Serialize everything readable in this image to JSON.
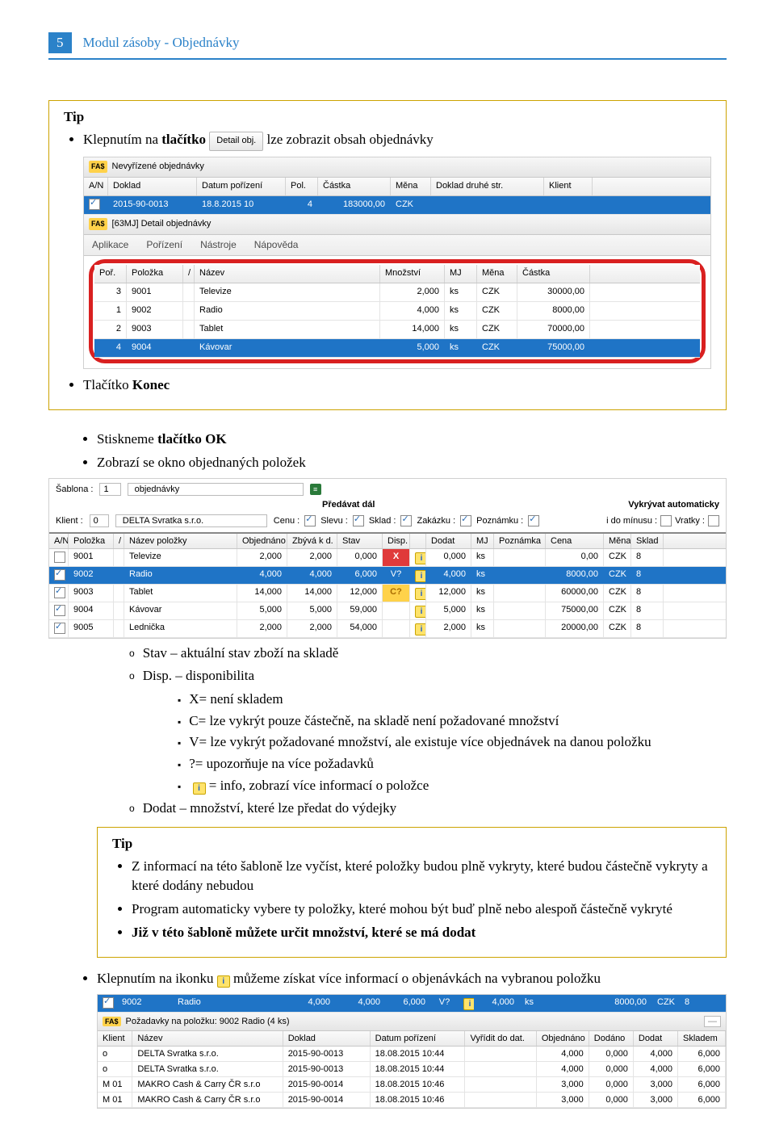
{
  "header": {
    "page_num": "5",
    "title": "Modul zásoby - Objednávky"
  },
  "tip1": {
    "title": "Tip",
    "b1_pre": "Klepnutím na ",
    "b1_bold": "tlačítko",
    "b1_btn": "Detail obj.",
    "b1_post": " lze zobrazit obsah objednávky",
    "b2_pre": "Tlačítko ",
    "b2_bold": "Konec"
  },
  "shot1": {
    "title_top": "Nevyřízené objednávky",
    "cols_top": [
      "A/N",
      "Doklad",
      "Datum pořízení",
      "Pol.",
      "Částka",
      "Měna",
      "Doklad druhé str.",
      "Klient"
    ],
    "row_top": {
      "an_on": true,
      "doklad": "2015-90-0013",
      "datum": "18.8.2015 10",
      "pol": "4",
      "castka": "183000,00",
      "mena": "CZK",
      "druha": "",
      "klient": ""
    },
    "title_detail": "[63MJ] Detail objednávky",
    "menu": [
      "Aplikace",
      "Pořízení",
      "Nástroje",
      "Nápověda"
    ],
    "detail_cols": [
      "Poř.",
      "Položka",
      "/",
      "Název",
      "Množství",
      "MJ",
      "Měna",
      "Částka"
    ],
    "detail_rows": [
      {
        "por": "3",
        "polozka": "9001",
        "nazev": "Televize",
        "mnoz": "2,000",
        "mj": "ks",
        "mena": "CZK",
        "castka": "30000,00"
      },
      {
        "por": "1",
        "polozka": "9002",
        "nazev": "Radio",
        "mnoz": "4,000",
        "mj": "ks",
        "mena": "CZK",
        "castka": "8000,00"
      },
      {
        "por": "2",
        "polozka": "9003",
        "nazev": "Tablet",
        "mnoz": "14,000",
        "mj": "ks",
        "mena": "CZK",
        "castka": "70000,00"
      },
      {
        "por": "4",
        "polozka": "9004",
        "nazev": "Kávovar",
        "mnoz": "5,000",
        "mj": "ks",
        "mena": "CZK",
        "castka": "75000,00",
        "sel": true
      }
    ]
  },
  "mid": {
    "b1_pre": "Stiskneme ",
    "b1_bold": "tlačítko OK",
    "b2": "Zobrazí se okno objednaných položek"
  },
  "shot2": {
    "row1": {
      "sablona_lbl": "Šablona :",
      "sablona_no": "1",
      "sablona_name": "objednávky",
      "predavat": "Předávat dál",
      "vykryvat": "Vykrývat automaticky"
    },
    "row2": {
      "klient_lbl": "Klient :",
      "klient_no": "0",
      "klient_name": "DELTA Svratka s.r.o.",
      "chks": [
        {
          "lbl": "Cenu :",
          "on": true
        },
        {
          "lbl": "Slevu :",
          "on": true
        },
        {
          "lbl": "Sklad :",
          "on": true
        },
        {
          "lbl": "Zakázku :",
          "on": true
        },
        {
          "lbl": "Poznámku :",
          "on": true
        }
      ],
      "dominus_lbl": "i do mínusu :",
      "dominus_on": false,
      "vratky_lbl": "Vratky :",
      "vratky_on": false
    },
    "cols": [
      "A/N",
      "Položka",
      "/",
      "Název položky",
      "Objednáno",
      "Zbývá k d.",
      "Stav",
      "Disp.",
      "",
      "Dodat",
      "MJ",
      "Poznámka",
      "Cena",
      "Měna",
      "Sklad"
    ],
    "rows": [
      {
        "an": false,
        "pol": "9001",
        "naz": "Televize",
        "obj": "2,000",
        "zbyva": "2,000",
        "stav": "0,000",
        "disp": "X",
        "disp_cls": "status-red",
        "info": "i",
        "dodat": "0,000",
        "mj": "ks",
        "pozn": "",
        "cena": "0,00",
        "mena": "CZK",
        "sklad": "8"
      },
      {
        "an": true,
        "pol": "9002",
        "naz": "Radio",
        "obj": "4,000",
        "zbyva": "4,000",
        "stav": "6,000",
        "disp": "V?",
        "disp_cls": "",
        "info": "i",
        "dodat": "4,000",
        "mj": "ks",
        "pozn": "",
        "cena": "8000,00",
        "mena": "CZK",
        "sklad": "8",
        "sel": true
      },
      {
        "an": true,
        "pol": "9003",
        "naz": "Tablet",
        "obj": "14,000",
        "zbyva": "14,000",
        "stav": "12,000",
        "disp": "C?",
        "disp_cls": "status-yellow",
        "info": "i",
        "dodat": "12,000",
        "mj": "ks",
        "pozn": "",
        "cena": "60000,00",
        "mena": "CZK",
        "sklad": "8"
      },
      {
        "an": true,
        "pol": "9004",
        "naz": "Kávovar",
        "obj": "5,000",
        "zbyva": "5,000",
        "stav": "59,000",
        "disp": "",
        "disp_cls": "",
        "info": "i",
        "dodat": "5,000",
        "mj": "ks",
        "pozn": "",
        "cena": "75000,00",
        "mena": "CZK",
        "sklad": "8"
      },
      {
        "an": true,
        "pol": "9005",
        "naz": "Lednička",
        "obj": "2,000",
        "zbyva": "2,000",
        "stav": "54,000",
        "disp": "",
        "disp_cls": "",
        "info": "i",
        "dodat": "2,000",
        "mj": "ks",
        "pozn": "",
        "cena": "20000,00",
        "mena": "CZK",
        "sklad": "8"
      }
    ]
  },
  "legend": {
    "o1": "Stav – aktuální stav zboží na skladě",
    "o2": "Disp. – disponibilita",
    "s1": "X= není skladem",
    "s2": "C= lze vykrýt pouze částečně, na skladě není požadované množství",
    "s3": "V= lze vykrýt požadované množství, ale existuje více objednávek na danou položku",
    "s4": "?= upozorňuje na více požadavků",
    "s5_post": "= info, zobrazí více informací o položce",
    "o3": "Dodat – množství, které lze předat do výdejky"
  },
  "tip2": {
    "title": "Tip",
    "b1": "Z informací na této šabloně lze vyčíst, které položky budou plně vykryty, které budou částečně vykryty a které dodány nebudou",
    "b2": "Program automaticky vybere ty položky, které mohou být buď plně nebo alespoň částečně vykryté",
    "b3": "Již v této šabloně můžete určit množství, které se má dodat"
  },
  "last": {
    "pre": "Klepnutím na ikonku ",
    "post": " můžeme získat více informací o objenávkách na vybranou položku"
  },
  "shot3": {
    "top_row": {
      "pol": "9002",
      "naz": "Radio",
      "obj": "4,000",
      "zbyva": "4,000",
      "stav": "6,000",
      "disp": "V?",
      "dodat": "4,000",
      "mj": "ks",
      "cena": "8000,00",
      "mena": "CZK",
      "sklad": "8"
    },
    "title": "Požadavky na položku: 9002 Radio (4 ks)",
    "cols": [
      "Klient",
      "Název",
      "Doklad",
      "Datum pořízení",
      "Vyřídit do dat.",
      "Objednáno",
      "Dodáno",
      "Dodat",
      "Skladem"
    ],
    "rows": [
      {
        "klient": "o",
        "nazev": "DELTA Svratka s.r.o.",
        "doklad": "2015-90-0013",
        "datum": "18.08.2015 10:44",
        "vyridit": "",
        "obj": "4,000",
        "dod": "0,000",
        "dodat": "4,000",
        "skl": "6,000"
      },
      {
        "klient": "o",
        "nazev": "DELTA Svratka s.r.o.",
        "doklad": "2015-90-0013",
        "datum": "18.08.2015 10:44",
        "vyridit": "",
        "obj": "4,000",
        "dod": "0,000",
        "dodat": "4,000",
        "skl": "6,000"
      },
      {
        "klient": "M 01",
        "nazev": "MAKRO Cash & Carry ČR s.r.o",
        "doklad": "2015-90-0014",
        "datum": "18.08.2015 10:46",
        "vyridit": "",
        "obj": "3,000",
        "dod": "0,000",
        "dodat": "3,000",
        "skl": "6,000"
      },
      {
        "klient": "M 01",
        "nazev": "MAKRO Cash & Carry ČR s.r.o",
        "doklad": "2015-90-0014",
        "datum": "18.08.2015 10:46",
        "vyridit": "",
        "obj": "3,000",
        "dod": "0,000",
        "dodat": "3,000",
        "skl": "6,000"
      }
    ]
  }
}
